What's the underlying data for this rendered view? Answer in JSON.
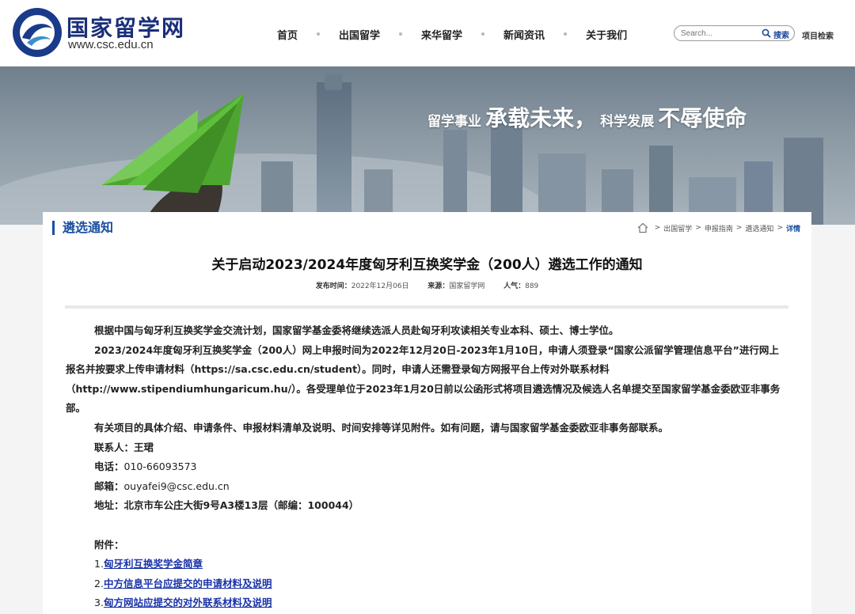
{
  "header": {
    "logo_cn": "国家留学网",
    "logo_url": "www.csc.edu.cn",
    "nav": [
      "首页",
      "出国留学",
      "来华留学",
      "新闻资讯",
      "关于我们"
    ],
    "search_placeholder": "Search...",
    "search_button": "搜索",
    "project_search": "项目检索"
  },
  "banner": {
    "slogan_1": "留学事业",
    "slogan_2": "承载未来，",
    "slogan_3": "科学发展",
    "slogan_4": "不辱使命"
  },
  "section": {
    "title": "遴选通知",
    "breadcrumb": [
      "出国留学",
      "申报指南",
      "遴选通知",
      "详情"
    ]
  },
  "article": {
    "title": "关于启动2023/2024年度匈牙利互换奖学金（200人）遴选工作的通知",
    "publish_label": "发布时间：",
    "publish_date": "2022年12月06日",
    "source_label": "来源：",
    "source": "国家留学网",
    "views_label": "人气：",
    "views": "889",
    "para1": "根据中国与匈牙利互换奖学金交流计划，国家留学基金委将继续选派人员赴匈牙利攻读相关专业本科、硕士、博士学位。",
    "para2_l1": "2023/2024年度匈牙利互换奖学金（200人）网上申报时间为2022年12月20日-2023年1月10日，申请人须登录“国家公派留学管理信息平台”进行网上",
    "para2_l2": "报名并按要求上传申请材料（https://sa.csc.edu.cn/student）。同时，申请人还需登录匈方网报平台上传对外联系材料",
    "para2_l3": "（http://www.stipendiumhungaricum.hu/）。各受理单位于2023年1月20日前以公函形式将项目遴选情况及候选人名单提交至国家留学基金委欧亚非事务",
    "para2_l4": "部。",
    "para3": "有关项目的具体介绍、申请条件、申报材料清单及说明、时间安排等详见附件。如有问题，请与国家留学基金委欧亚非事务部联系。",
    "contact_label": "联系人：",
    "contact": "王珺",
    "phone_label": "电话：",
    "phone": "010-66093573",
    "email_label": "邮箱：",
    "email": "ouyafei9@csc.edu.cn",
    "address_label": "地址：",
    "address": "北京市车公庄大街9号A3楼13层（邮编：100044）",
    "attach_label": "附件：",
    "attachments": [
      {
        "num": "1.",
        "label": "匈牙利互换奖学金简章"
      },
      {
        "num": "2.",
        "label": "中方信息平台应提交的申请材料及说明"
      },
      {
        "num": "3.",
        "label": "匈方网站应提交的对外联系材料及说明"
      }
    ]
  },
  "colors": {
    "brand_blue": "#1a4fa0",
    "link_blue": "#1a33a8",
    "plane_green": "#5fbf3c"
  }
}
